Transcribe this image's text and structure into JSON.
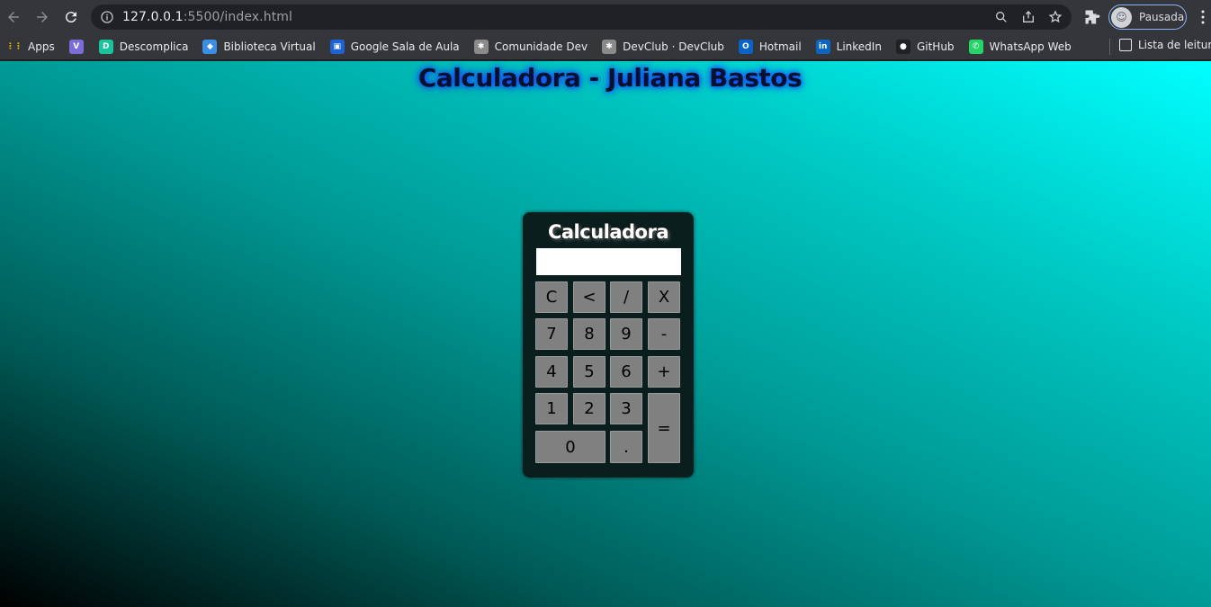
{
  "browser": {
    "url_host": "127.0.0.1",
    "url_rest": ":5500/index.html",
    "profile_label": "Pausada",
    "bookmarks": [
      {
        "label": "Apps",
        "icon": "apps-grid-icon",
        "color": "#e8eaed"
      },
      {
        "label": "",
        "icon": "v-logo-icon",
        "color": "#7b6cd9"
      },
      {
        "label": "Descomplica",
        "icon": "descomplica-icon",
        "color": "#19c39c"
      },
      {
        "label": "Biblioteca Virtual",
        "icon": "biblioteca-icon",
        "color": "#3a8ee6"
      },
      {
        "label": "Google Sala de Aula",
        "icon": "classroom-icon",
        "color": "#1e63d6"
      },
      {
        "label": "Comunidade Dev",
        "icon": "comunidade-dev-icon",
        "color": "#8a8a8a"
      },
      {
        "label": "DevClub · DevClub",
        "icon": "devclub-icon",
        "color": "#8a8a8a"
      },
      {
        "label": "Hotmail",
        "icon": "outlook-icon",
        "color": "#0a64c8"
      },
      {
        "label": "LinkedIn",
        "icon": "linkedin-icon",
        "color": "#0a66c2"
      },
      {
        "label": "GitHub",
        "icon": "github-icon",
        "color": "#202124"
      },
      {
        "label": "WhatsApp Web",
        "icon": "whatsapp-icon",
        "color": "#25d366"
      }
    ],
    "reading_list": "Lista de leitura"
  },
  "page": {
    "title": "Calculadora - Juliana Bastos"
  },
  "calculator": {
    "title": "Calculadora",
    "display_value": "",
    "keys": {
      "clear": "C",
      "backspace": "<",
      "divide": "/",
      "multiply": "X",
      "seven": "7",
      "eight": "8",
      "nine": "9",
      "minus": "-",
      "four": "4",
      "five": "5",
      "six": "6",
      "plus": "+",
      "one": "1",
      "two": "2",
      "three": "3",
      "equals": "=",
      "zero": "0",
      "dot": "."
    }
  }
}
